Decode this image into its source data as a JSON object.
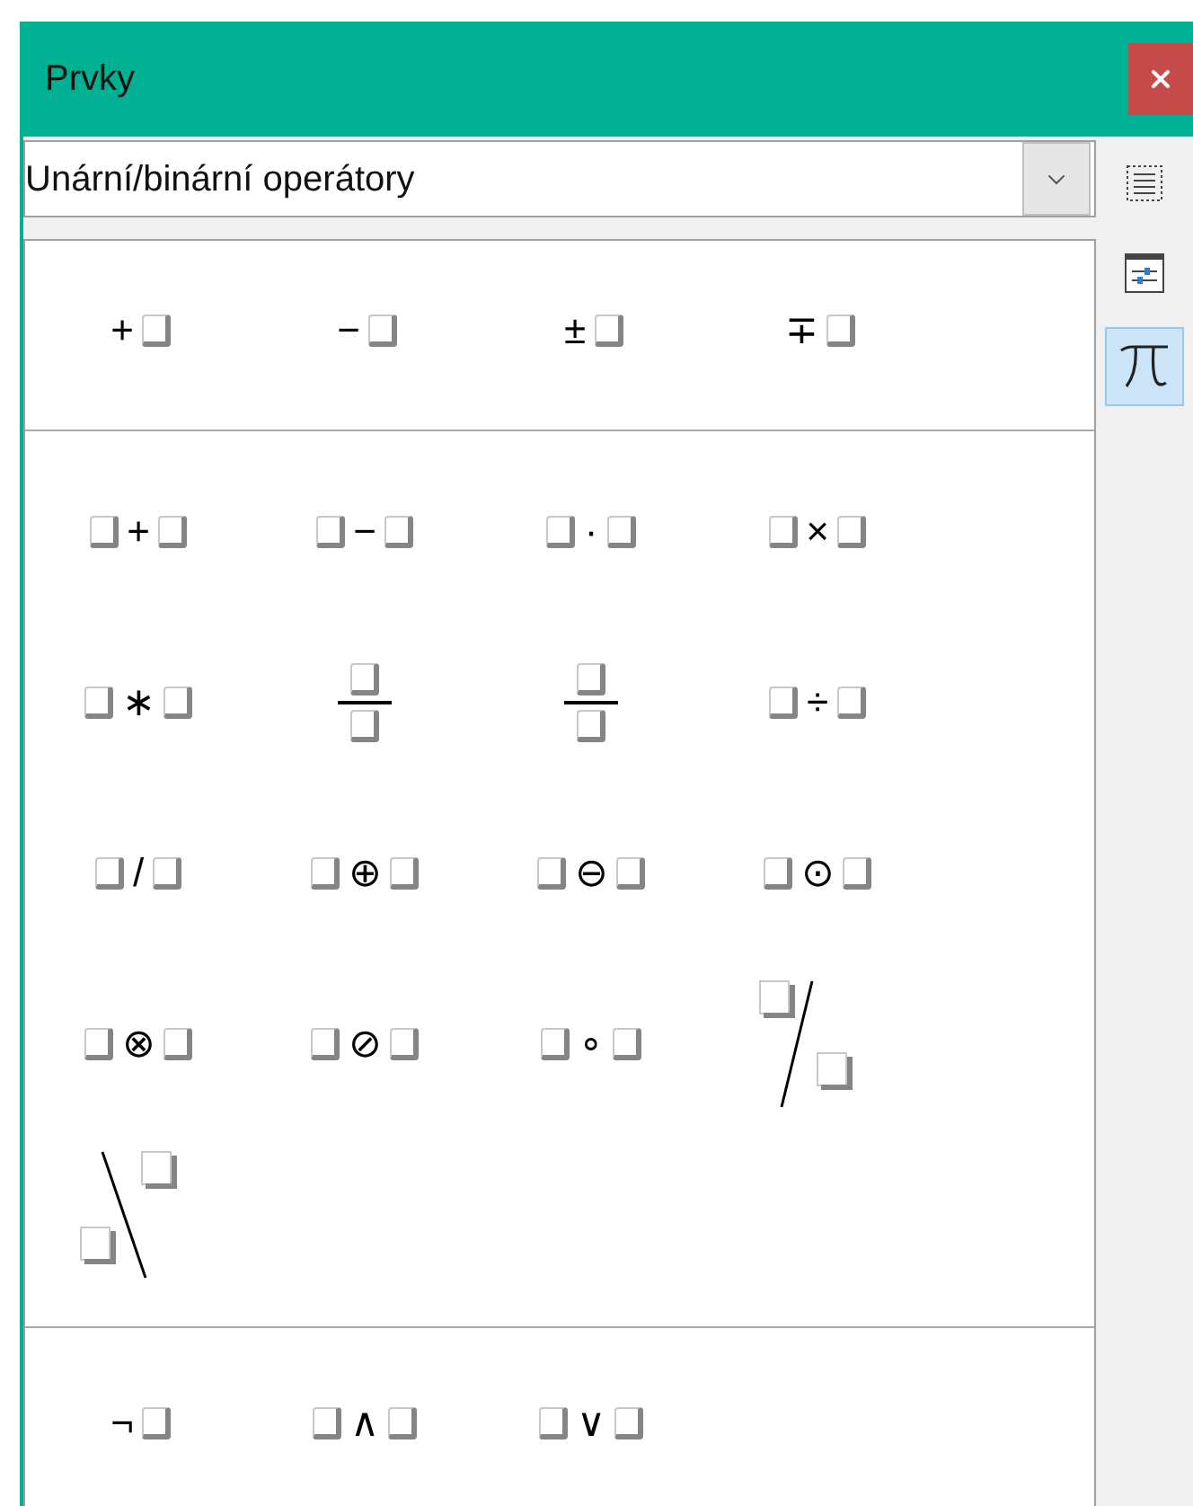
{
  "panel": {
    "title": "Prvky"
  },
  "category_dropdown": {
    "value": "Unární/binární operátory"
  },
  "sidebar_tabs": [
    {
      "kind": "list",
      "selected": false
    },
    {
      "kind": "properties",
      "selected": false
    },
    {
      "kind": "pi",
      "selected": true
    }
  ],
  "sections": [
    {
      "elements": [
        {
          "kind": "prefix",
          "symbol": "+"
        },
        {
          "kind": "prefix",
          "symbol": "−"
        },
        {
          "kind": "prefix",
          "symbol": "±"
        },
        {
          "kind": "prefix",
          "symbol": "∓"
        }
      ]
    },
    {
      "elements": [
        {
          "kind": "infix",
          "symbol": "+"
        },
        {
          "kind": "infix",
          "symbol": "−"
        },
        {
          "kind": "infix",
          "symbol": "·"
        },
        {
          "kind": "infix",
          "symbol": "×"
        },
        {
          "kind": "infix",
          "symbol": "∗"
        },
        {
          "kind": "fraction"
        },
        {
          "kind": "fraction"
        },
        {
          "kind": "infix",
          "symbol": "÷"
        },
        {
          "kind": "infix",
          "symbol": "/"
        },
        {
          "kind": "infix",
          "symbol": "⊕"
        },
        {
          "kind": "infix",
          "symbol": "⊖"
        },
        {
          "kind": "infix",
          "symbol": "⊙"
        },
        {
          "kind": "infix",
          "symbol": "⊗"
        },
        {
          "kind": "infix",
          "symbol": "⊘"
        },
        {
          "kind": "infix",
          "symbol": "∘"
        },
        {
          "kind": "wideslash"
        },
        {
          "kind": "widebslash"
        }
      ]
    },
    {
      "elements": [
        {
          "kind": "prefix",
          "symbol": "¬"
        },
        {
          "kind": "infix",
          "symbol": "∧"
        },
        {
          "kind": "infix",
          "symbol": "∨"
        }
      ]
    }
  ]
}
